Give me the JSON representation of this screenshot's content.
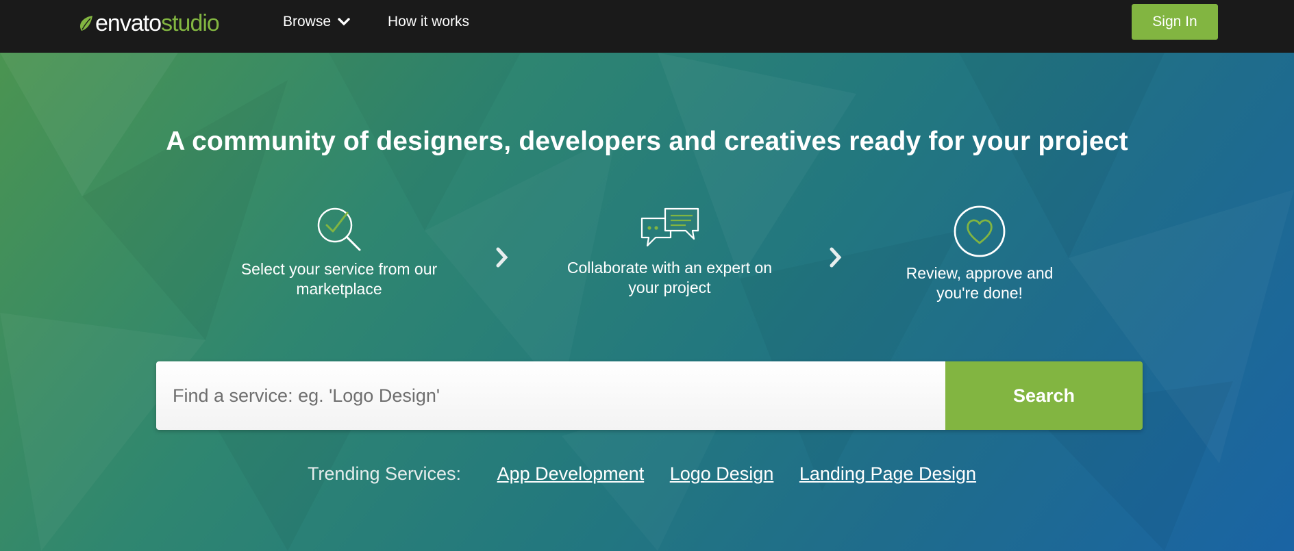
{
  "nav": {
    "logo_part1": "envato",
    "logo_part2": "studio",
    "browse_label": "Browse",
    "how_it_works_label": "How it works",
    "signin_label": "Sign In"
  },
  "hero": {
    "headline": "A community of designers, developers and creatives ready for your project",
    "steps": [
      {
        "line1": "Select your service from our",
        "line2": "marketplace",
        "icon": "search-check-icon"
      },
      {
        "line1": "Collaborate with an expert on",
        "line2": "your project",
        "icon": "chat-bubbles-icon"
      },
      {
        "line1": "Review, approve and",
        "line2": "you're done!",
        "icon": "heart-circle-icon"
      }
    ]
  },
  "search": {
    "placeholder": "Find a service: eg. 'Logo Design'",
    "button_label": "Search"
  },
  "trending": {
    "label": "Trending Services:",
    "links": [
      "App Development",
      "Logo Design",
      "Landing Page Design"
    ]
  },
  "colors": {
    "accent": "#82b541",
    "topbar": "#1a1a1a",
    "hero_start": "#4b9451",
    "hero_end": "#1a64a4"
  }
}
